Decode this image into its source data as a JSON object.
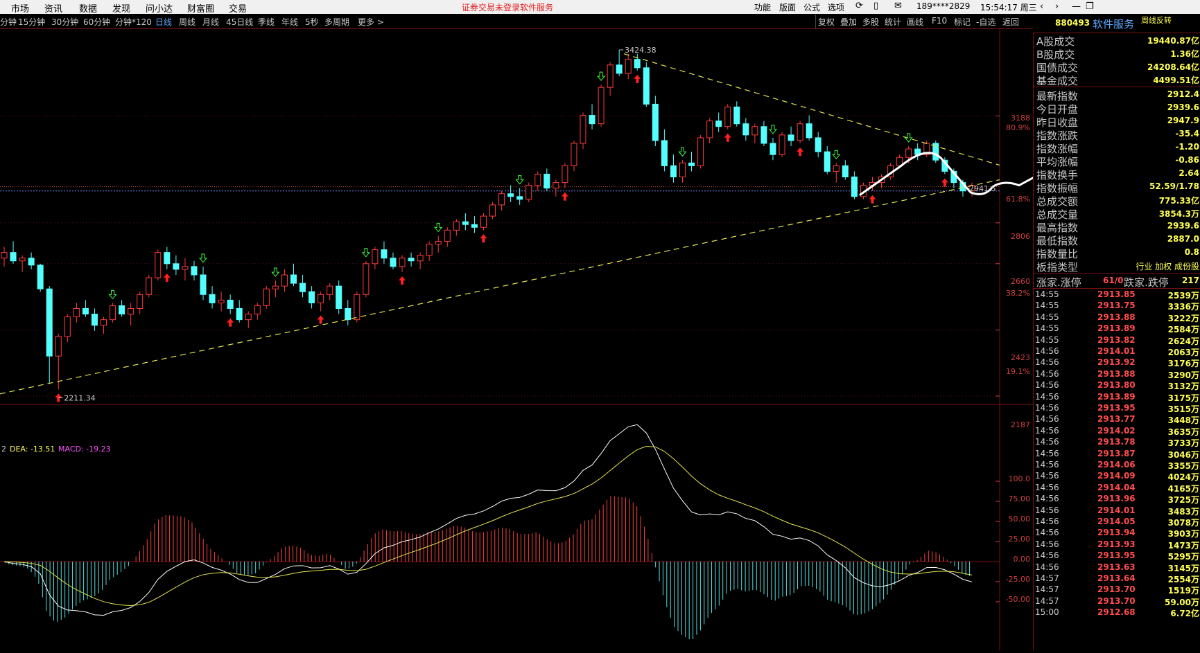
{
  "menu": {
    "items": [
      "市场",
      "资讯",
      "数据",
      "发现",
      "问小达",
      "财富圈",
      "交易"
    ],
    "warning": "证券交易未登录",
    "service": "软件服务",
    "right_items": [
      "功能",
      "版面",
      "公式",
      "选项"
    ],
    "user": "189****2829",
    "clock": "15:54:17 周三"
  },
  "periods": [
    "分钟",
    "15分钟",
    "30分钟",
    "60分钟",
    "分钟*120",
    "日线",
    "周线",
    "月线",
    "45日线",
    "季线",
    "年线",
    "5秒",
    "多周期",
    "更多 >"
  ],
  "active_period": "日线",
  "tools": [
    "复权",
    "叠加",
    "多股",
    "统计",
    "画线",
    "F10",
    "标记",
    "-自选",
    "返回"
  ],
  "stock": {
    "code": "880493",
    "name": "软件服务",
    "tag": "周线反转"
  },
  "chart_data": {
    "type": "candlestick",
    "y_ticks": [
      "3188",
      "2806",
      "2660",
      "2423",
      "2187"
    ],
    "pct_labels": [
      "80.9%",
      "61.8%",
      "38.2%",
      "19.1%"
    ],
    "high_label": "3424.38",
    "low_label": "2211.34",
    "last_label": "2941.5",
    "candles": [
      [
        2680,
        2720,
        2650,
        2700
      ],
      [
        2700,
        2740,
        2660,
        2670
      ],
      [
        2670,
        2690,
        2630,
        2680
      ],
      [
        2680,
        2700,
        2640,
        2655
      ],
      [
        2655,
        2660,
        2560,
        2570
      ],
      [
        2570,
        2580,
        2230,
        2330
      ],
      [
        2330,
        2410,
        2211,
        2400
      ],
      [
        2400,
        2480,
        2380,
        2470
      ],
      [
        2470,
        2520,
        2450,
        2500
      ],
      [
        2500,
        2530,
        2470,
        2480
      ],
      [
        2480,
        2500,
        2420,
        2440
      ],
      [
        2440,
        2470,
        2410,
        2460
      ],
      [
        2460,
        2520,
        2450,
        2510
      ],
      [
        2510,
        2530,
        2470,
        2480
      ],
      [
        2480,
        2520,
        2440,
        2500
      ],
      [
        2500,
        2560,
        2480,
        2550
      ],
      [
        2550,
        2620,
        2540,
        2610
      ],
      [
        2610,
        2710,
        2600,
        2700
      ],
      [
        2700,
        2720,
        2640,
        2660
      ],
      [
        2660,
        2690,
        2620,
        2640
      ],
      [
        2640,
        2680,
        2600,
        2650
      ],
      [
        2650,
        2670,
        2600,
        2620
      ],
      [
        2620,
        2650,
        2530,
        2550
      ],
      [
        2550,
        2580,
        2500,
        2520
      ],
      [
        2520,
        2560,
        2490,
        2530
      ],
      [
        2530,
        2550,
        2480,
        2500
      ],
      [
        2500,
        2530,
        2450,
        2460
      ],
      [
        2460,
        2490,
        2430,
        2480
      ],
      [
        2480,
        2520,
        2460,
        2510
      ],
      [
        2510,
        2580,
        2500,
        2570
      ],
      [
        2570,
        2600,
        2540,
        2580
      ],
      [
        2580,
        2640,
        2560,
        2620
      ],
      [
        2620,
        2660,
        2580,
        2590
      ],
      [
        2590,
        2620,
        2540,
        2560
      ],
      [
        2560,
        2580,
        2500,
        2520
      ],
      [
        2520,
        2560,
        2490,
        2550
      ],
      [
        2550,
        2590,
        2530,
        2580
      ],
      [
        2580,
        2600,
        2480,
        2500
      ],
      [
        2500,
        2530,
        2440,
        2460
      ],
      [
        2460,
        2560,
        2450,
        2550
      ],
      [
        2550,
        2670,
        2540,
        2660
      ],
      [
        2660,
        2720,
        2640,
        2710
      ],
      [
        2710,
        2740,
        2660,
        2680
      ],
      [
        2680,
        2700,
        2640,
        2650
      ],
      [
        2650,
        2690,
        2630,
        2680
      ],
      [
        2680,
        2700,
        2650,
        2670
      ],
      [
        2670,
        2700,
        2640,
        2690
      ],
      [
        2690,
        2740,
        2670,
        2730
      ],
      [
        2730,
        2760,
        2700,
        2740
      ],
      [
        2740,
        2790,
        2720,
        2780
      ],
      [
        2780,
        2820,
        2760,
        2810
      ],
      [
        2810,
        2840,
        2780,
        2800
      ],
      [
        2800,
        2830,
        2770,
        2790
      ],
      [
        2790,
        2840,
        2780,
        2830
      ],
      [
        2830,
        2880,
        2820,
        2870
      ],
      [
        2870,
        2920,
        2850,
        2910
      ],
      [
        2910,
        2940,
        2880,
        2900
      ],
      [
        2900,
        2930,
        2870,
        2890
      ],
      [
        2890,
        2950,
        2880,
        2940
      ],
      [
        2940,
        2990,
        2920,
        2980
      ],
      [
        2980,
        3000,
        2920,
        2930
      ],
      [
        2930,
        2960,
        2900,
        2950
      ],
      [
        2950,
        3020,
        2930,
        3010
      ],
      [
        3010,
        3100,
        2990,
        3090
      ],
      [
        3090,
        3200,
        3070,
        3190
      ],
      [
        3190,
        3230,
        3140,
        3160
      ],
      [
        3160,
        3300,
        3150,
        3290
      ],
      [
        3290,
        3380,
        3260,
        3370
      ],
      [
        3370,
        3424,
        3330,
        3340
      ],
      [
        3340,
        3410,
        3320,
        3390
      ],
      [
        3390,
        3410,
        3350,
        3360
      ],
      [
        3360,
        3380,
        3220,
        3230
      ],
      [
        3230,
        3260,
        3080,
        3100
      ],
      [
        3100,
        3140,
        2990,
        3010
      ],
      [
        3010,
        3050,
        2950,
        2970
      ],
      [
        2970,
        3030,
        2950,
        3020
      ],
      [
        3020,
        3060,
        2990,
        3010
      ],
      [
        3010,
        3120,
        3000,
        3110
      ],
      [
        3110,
        3180,
        3090,
        3170
      ],
      [
        3170,
        3200,
        3130,
        3150
      ],
      [
        3150,
        3230,
        3140,
        3220
      ],
      [
        3220,
        3240,
        3150,
        3160
      ],
      [
        3160,
        3180,
        3100,
        3120
      ],
      [
        3120,
        3160,
        3090,
        3150
      ],
      [
        3150,
        3170,
        3080,
        3090
      ],
      [
        3090,
        3110,
        3030,
        3050
      ],
      [
        3050,
        3130,
        3040,
        3120
      ],
      [
        3120,
        3150,
        3080,
        3100
      ],
      [
        3100,
        3170,
        3090,
        3160
      ],
      [
        3160,
        3190,
        3100,
        3110
      ],
      [
        3110,
        3130,
        3040,
        3060
      ],
      [
        3060,
        3080,
        2980,
        2990
      ],
      [
        2990,
        3020,
        2950,
        3010
      ],
      [
        3010,
        3030,
        2960,
        2970
      ],
      [
        2970,
        2990,
        2890,
        2900
      ],
      [
        2900,
        2950,
        2890,
        2940
      ],
      [
        2940,
        2970,
        2920,
        2950
      ],
      [
        2950,
        2980,
        2930,
        2970
      ],
      [
        2970,
        3020,
        2960,
        3010
      ],
      [
        3010,
        3050,
        3000,
        3040
      ],
      [
        3040,
        3080,
        3020,
        3070
      ],
      [
        3070,
        3090,
        3030,
        3050
      ],
      [
        3050,
        3100,
        3040,
        3090
      ],
      [
        3090,
        3100,
        3020,
        3030
      ],
      [
        3030,
        3040,
        2980,
        2990
      ],
      [
        2990,
        3000,
        2930,
        2950
      ],
      [
        2950,
        2960,
        2900,
        2920
      ],
      [
        2920,
        2950,
        2900,
        2940
      ]
    ],
    "macd_labels": {
      "prefix": "2",
      "dea": "DEA: -13.51",
      "macd": "MACD: -19.23"
    },
    "macd_ticks": [
      "100.0",
      "75.00",
      "50.00",
      "25.00",
      "0.00",
      "-25.00",
      "-50.00"
    ]
  },
  "stats": [
    {
      "label": "A股成交",
      "value": "19440.87亿"
    },
    {
      "label": "B股成交",
      "value": "1.36亿"
    },
    {
      "label": "国债成交",
      "value": "24208.64亿"
    },
    {
      "label": "基金成交",
      "value": "4499.51亿"
    },
    {
      "label": "最新指数",
      "value": "2912.4"
    },
    {
      "label": "今日开盘",
      "value": "2939.6"
    },
    {
      "label": "昨日收盘",
      "value": "2947.9"
    },
    {
      "label": "指数涨跌",
      "value": "-35.4"
    },
    {
      "label": "指数涨幅",
      "value": "-1.20"
    },
    {
      "label": "平均涨幅",
      "value": "-0.86"
    },
    {
      "label": "指数换手",
      "value": "2.64"
    },
    {
      "label": "指数振幅",
      "value": "52.59/1.78"
    },
    {
      "label": "总成交额",
      "value": "775.33亿"
    },
    {
      "label": "总成交量",
      "value": "3854.3万"
    },
    {
      "label": "最高指数",
      "value": "2939.6"
    },
    {
      "label": "最低指数",
      "value": "2887.0"
    },
    {
      "label": "指数量比",
      "value": "0.8"
    },
    {
      "label": "板指类型",
      "value": "行业 加权 成份股"
    }
  ],
  "updown": {
    "up_label": "涨家.涨停",
    "up_value": "61/0",
    "down_label": "跌家.跌停",
    "down_value": "217"
  },
  "ticks": [
    {
      "time": "14:55",
      "price": "2913.85",
      "vol": "2539万"
    },
    {
      "time": "14:55",
      "price": "2913.75",
      "vol": "3336万"
    },
    {
      "time": "14:55",
      "price": "2913.88",
      "vol": "3222万"
    },
    {
      "time": "14:55",
      "price": "2913.89",
      "vol": "2584万"
    },
    {
      "time": "14:55",
      "price": "2913.82",
      "vol": "2624万"
    },
    {
      "time": "14:56",
      "price": "2914.01",
      "vol": "2063万"
    },
    {
      "time": "14:56",
      "price": "2913.92",
      "vol": "3176万"
    },
    {
      "time": "14:56",
      "price": "2913.88",
      "vol": "3290万"
    },
    {
      "time": "14:56",
      "price": "2913.80",
      "vol": "3132万"
    },
    {
      "time": "14:56",
      "price": "2913.89",
      "vol": "3175万"
    },
    {
      "time": "14:56",
      "price": "2913.95",
      "vol": "3515万"
    },
    {
      "time": "14:56",
      "price": "2913.77",
      "vol": "3448万"
    },
    {
      "time": "14:56",
      "price": "2914.02",
      "vol": "3635万"
    },
    {
      "time": "14:56",
      "price": "2913.78",
      "vol": "3733万"
    },
    {
      "time": "14:56",
      "price": "2913.87",
      "vol": "3046万"
    },
    {
      "time": "14:56",
      "price": "2914.06",
      "vol": "3355万"
    },
    {
      "time": "14:56",
      "price": "2914.09",
      "vol": "4024万"
    },
    {
      "time": "14:56",
      "price": "2914.04",
      "vol": "4165万"
    },
    {
      "time": "14:56",
      "price": "2913.96",
      "vol": "3725万"
    },
    {
      "time": "14:56",
      "price": "2914.01",
      "vol": "3483万"
    },
    {
      "time": "14:56",
      "price": "2914.05",
      "vol": "3078万"
    },
    {
      "time": "14:56",
      "price": "2913.94",
      "vol": "3903万"
    },
    {
      "time": "14:56",
      "price": "2913.93",
      "vol": "1473万"
    },
    {
      "time": "14:56",
      "price": "2913.95",
      "vol": "5295万"
    },
    {
      "time": "14:56",
      "price": "2913.63",
      "vol": "3145万"
    },
    {
      "time": "14:57",
      "price": "2913.64",
      "vol": "2554万"
    },
    {
      "time": "14:57",
      "price": "2913.70",
      "vol": "1519万"
    },
    {
      "time": "14:57",
      "price": "2913.70",
      "vol": "59.00万"
    },
    {
      "time": "15:00",
      "price": "2912.68",
      "vol": "6.72亿"
    }
  ]
}
